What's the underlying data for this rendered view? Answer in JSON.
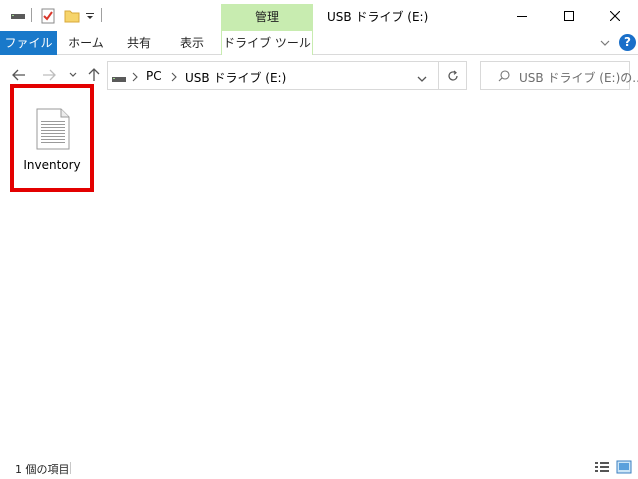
{
  "titlebar": {
    "contextual_tab_label": "管理",
    "window_title": "USB ドライブ (E:)"
  },
  "ribbon": {
    "tabs": [
      {
        "label": "ファイル"
      },
      {
        "label": "ホーム"
      },
      {
        "label": "共有"
      },
      {
        "label": "表示"
      },
      {
        "label": "ドライブ ツール"
      }
    ],
    "help_label": "?"
  },
  "address_bar": {
    "breadcrumb": [
      "PC",
      "USB ドライブ (E:)"
    ]
  },
  "search": {
    "placeholder": "USB ドライブ (E:)の..."
  },
  "content": {
    "items": [
      {
        "name": "Inventory",
        "icon": "text-document-icon"
      }
    ]
  },
  "status_bar": {
    "item_count": "1 個の項目"
  },
  "colors": {
    "file_tab": "#1979ca",
    "contextual_tab": "#c8ecb0",
    "selection_highlight": "#e30000",
    "help_icon": "#1a6fc9"
  }
}
